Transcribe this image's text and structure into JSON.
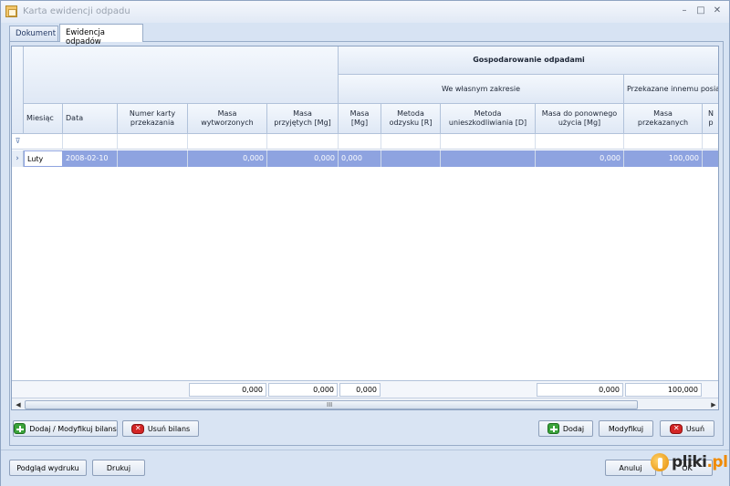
{
  "window": {
    "title": "Karta ewidencji odpadu",
    "controls": {
      "minimize": "–",
      "maximize": "□",
      "close": "✕"
    }
  },
  "tabs": [
    {
      "label": "Dokument",
      "active": false
    },
    {
      "label": "Ewidencja odpadów",
      "active": true
    }
  ],
  "grid": {
    "group_header": "Gospodarowanie odpadami",
    "sub_groups": {
      "own": "We własnym zakresie",
      "transfer": "Przekazane innemu posia"
    },
    "columns": {
      "month": "Miesiąc",
      "date": "Data",
      "card_number": [
        "Numer karty",
        "przekazania"
      ],
      "mass_generated": [
        "Masa",
        "wytworzonych"
      ],
      "mass_received": [
        "Masa",
        "przyjętych [Mg]"
      ],
      "mass_mg": [
        "Masa",
        "[Mg]"
      ],
      "recovery_method": [
        "Metoda",
        "odzysku [R]"
      ],
      "disposal_method": [
        "Metoda",
        "unieszkodliwiania [D]"
      ],
      "reuse_mass": [
        "Masa do ponownego",
        "użycia [Mg]"
      ],
      "transferred_mass": [
        "Masa",
        "przekazanych"
      ],
      "next_partial": [
        "N",
        "p"
      ]
    },
    "filter_icon": "filter-icon",
    "rows": [
      {
        "indicator": "›",
        "month": "Luty",
        "date": "2008-02-10",
        "card_number": "",
        "mass_generated": "0,000",
        "mass_received": "0,000",
        "mass_mg": "0,000",
        "recovery_method": "",
        "disposal_method": "",
        "reuse_mass": "0,000",
        "transferred_mass": "100,000"
      }
    ],
    "summary": {
      "mass_generated": "0,000",
      "mass_received": "0,000",
      "mass_mg": "0,000",
      "reuse_mass": "0,000",
      "transferred_mass": "100,000"
    },
    "scrollbar": {
      "left": "◀",
      "right": "▶",
      "grip": "III"
    }
  },
  "buttons": {
    "add_modify_balance": "Dodaj / Modyfikuj bilans",
    "delete_balance": "Usuń bilans",
    "add": "Dodaj",
    "modify": "Modyfikuj",
    "delete": "Usuń",
    "print_preview": "Podgląd wydruku",
    "print": "Drukuj",
    "cancel": "Anuluj",
    "ok": "OK"
  },
  "watermark": {
    "brand": "pliki",
    "tld": ".pl"
  },
  "colors": {
    "selection": "#8ea3e0",
    "header": "#dfe8f5",
    "add_icon": "#3aa33a",
    "delete_icon": "#d42525",
    "brand_accent": "#f08a00"
  }
}
